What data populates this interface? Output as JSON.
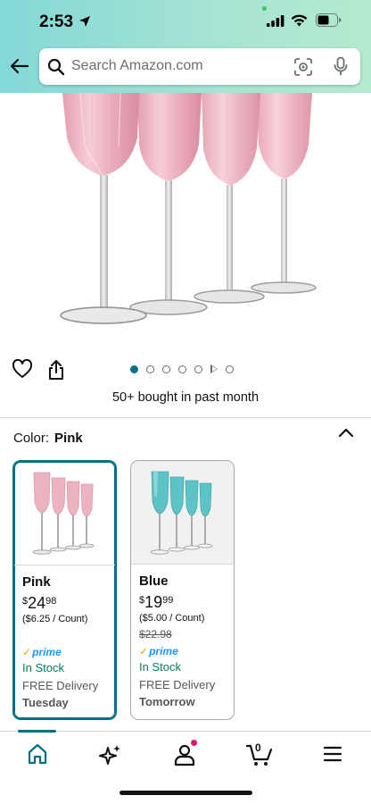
{
  "status_bar": {
    "time": "2:53"
  },
  "search": {
    "placeholder": "Search Amazon.com"
  },
  "product": {
    "image_count": 7,
    "active_image_index": 0,
    "bought_text": "50+ bought in past month"
  },
  "color": {
    "label": "Color:",
    "selected": "Pink"
  },
  "swatches": [
    {
      "name": "Pink",
      "price_currency": "$",
      "price_whole": "24",
      "price_cents": "98",
      "unit_price": "($6.25 / Count)",
      "list_price": "",
      "prime": "prime",
      "stock": "In Stock",
      "delivery": "FREE Delivery",
      "day": "Tuesday",
      "selected": true,
      "glass_color": "#e7a9b5"
    },
    {
      "name": "Blue",
      "price_currency": "$",
      "price_whole": "19",
      "price_cents": "99",
      "unit_price": "($5.00 / Count)",
      "list_price": "$22.98",
      "prime": "prime",
      "stock": "In Stock",
      "delivery": "FREE Delivery",
      "day": "Tomorrow",
      "selected": false,
      "glass_color": "#5ec3c6"
    }
  ],
  "nav": {
    "cart_count": "0",
    "items": [
      "home-icon",
      "ai-sparkle-icon",
      "account-icon",
      "cart-icon",
      "menu-icon"
    ]
  },
  "colors": {
    "header_start": "#83d8d8",
    "header_end": "#b6ead0",
    "accent": "#007185",
    "in_stock": "#067d62",
    "prime_blue": "#1a98ff"
  }
}
